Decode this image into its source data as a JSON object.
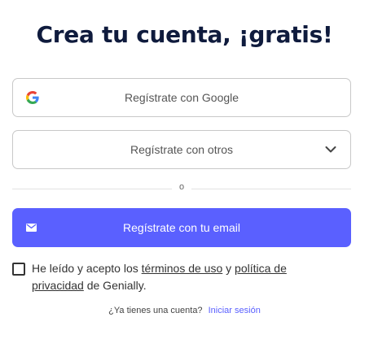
{
  "title": "Crea tu cuenta, ¡gratis!",
  "google_button": {
    "label": "Regístrate con Google",
    "icon": "google-logo-icon"
  },
  "others_button": {
    "label": "Regístrate con otros",
    "icon": "chevron-down-icon"
  },
  "divider_text": "o",
  "email_button": {
    "label": "Regístrate con tu email",
    "icon": "envelope-icon"
  },
  "terms": {
    "checked": false,
    "prefix": "He leído y acepto los",
    "terms_link": "términos de uso",
    "connector": "y",
    "privacy_link_1": "política de",
    "privacy_link_2": "privacidad",
    "suffix": "de Genially."
  },
  "login_prompt": {
    "question": "¿Ya tienes una cuenta?",
    "link": "Iniciar sesión"
  },
  "colors": {
    "accent": "#5a60ff",
    "title": "#0f1b3d",
    "border": "#c8c8c8"
  }
}
